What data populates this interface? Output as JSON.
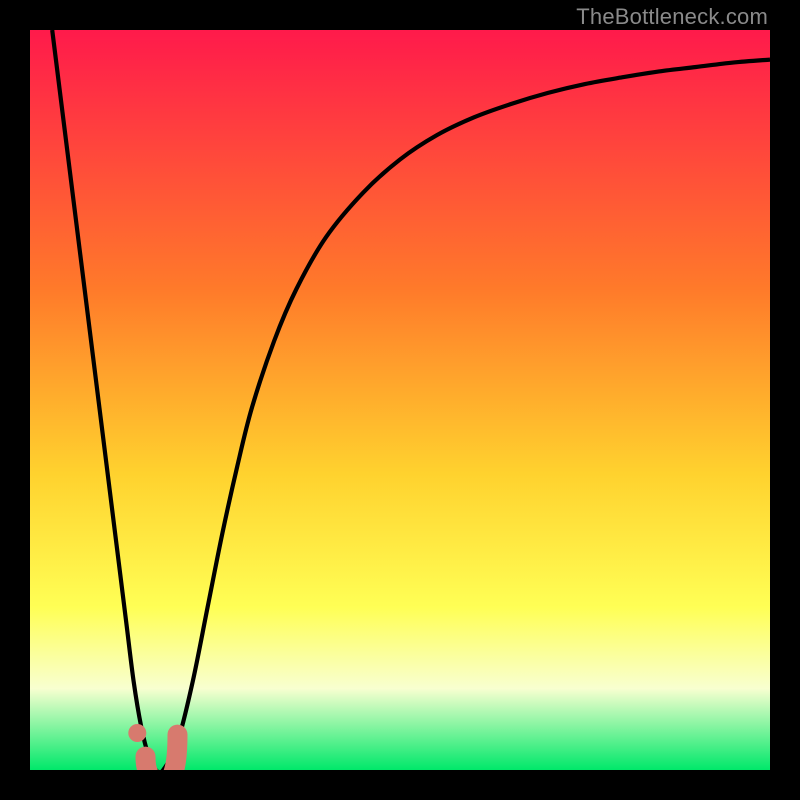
{
  "watermark": "TheBottleneck.com",
  "colors": {
    "black": "#000000",
    "curve": "#000000",
    "marker_fill": "#d77a6e",
    "grad_top": "#ff1a4b",
    "grad_mid1": "#ff7a2a",
    "grad_mid2": "#ffd22e",
    "grad_yellow": "#ffff55",
    "grad_pale": "#f8ffd0",
    "grad_green": "#00e86a"
  },
  "chart_data": {
    "type": "line",
    "title": "",
    "xlabel": "",
    "ylabel": "",
    "xlim": [
      0,
      100
    ],
    "ylim": [
      0,
      100
    ],
    "x": [
      3,
      4,
      5,
      6,
      7,
      8,
      9,
      10,
      11,
      12,
      13,
      14,
      15,
      16,
      17,
      18,
      20,
      22,
      24,
      26,
      28,
      30,
      33,
      36,
      40,
      45,
      50,
      55,
      60,
      65,
      70,
      75,
      80,
      85,
      90,
      95,
      100
    ],
    "y": [
      100,
      92,
      84,
      76,
      68,
      60,
      52,
      44,
      36,
      28,
      20,
      12,
      6,
      2,
      0,
      0,
      4,
      12,
      22,
      32,
      41,
      49,
      58,
      65,
      72,
      78,
      82.5,
      85.8,
      88.2,
      90,
      91.5,
      92.7,
      93.6,
      94.4,
      95,
      95.6,
      96
    ],
    "markers": [
      {
        "shape": "dot",
        "x": 14.5,
        "y": 5
      },
      {
        "shape": "hook",
        "x": 17.5,
        "y": 1
      }
    ],
    "gradient_stops_pct": [
      {
        "p": 0,
        "c": "grad_top"
      },
      {
        "p": 35,
        "c": "grad_mid1"
      },
      {
        "p": 60,
        "c": "grad_mid2"
      },
      {
        "p": 78,
        "c": "grad_yellow"
      },
      {
        "p": 89,
        "c": "grad_pale"
      },
      {
        "p": 100,
        "c": "grad_green"
      }
    ]
  }
}
